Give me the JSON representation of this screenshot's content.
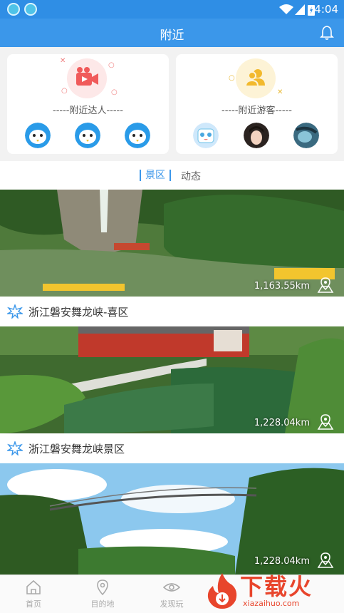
{
  "status_bar": {
    "time": "4:04"
  },
  "header": {
    "title": "附近"
  },
  "cards": {
    "experts": {
      "label": "-----附近达人-----"
    },
    "visitors": {
      "label": "-----附近游客-----"
    }
  },
  "tabs": [
    {
      "label": "景区"
    },
    {
      "label": "动态"
    }
  ],
  "spots": [
    {
      "name": "浙江磐安舞龙峡-喜区",
      "distance": "1,163.55km"
    },
    {
      "name": "浙江磐安舞龙峡景区",
      "distance": "1,228.04km"
    },
    {
      "name": "",
      "distance": "1,228.04km"
    }
  ],
  "bottom_nav": [
    {
      "label": "首页",
      "icon": "home-icon"
    },
    {
      "label": "目的地",
      "icon": "location-pin-icon"
    },
    {
      "label": "发现玩",
      "icon": "eye-icon"
    }
  ],
  "watermark": {
    "text": "下载火",
    "url": "xiazaihuo.com"
  },
  "colors": {
    "primary": "#3b97ea",
    "accent_red": "#f05a5a",
    "accent_yellow": "#f2b92d"
  }
}
